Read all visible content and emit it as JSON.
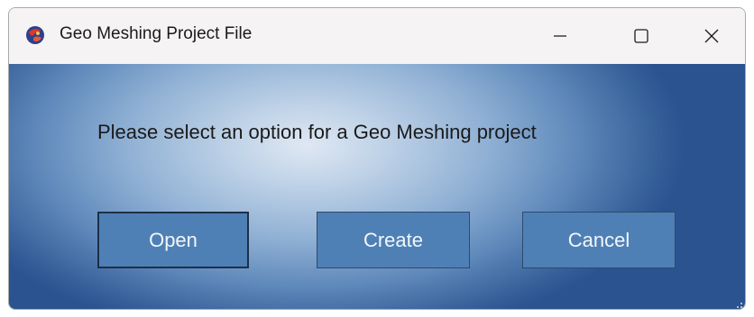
{
  "window": {
    "title": "Geo Meshing Project File",
    "icon": "app-globe-icon",
    "controls": {
      "minimize_icon": "minimize-icon",
      "maximize_icon": "maximize-icon",
      "close_icon": "close-icon"
    }
  },
  "dialog": {
    "prompt": "Please select an option for a Geo Meshing project",
    "buttons": {
      "open": "Open",
      "create": "Create",
      "cancel": "Cancel"
    }
  },
  "colors": {
    "button_fill": "#4f80b5",
    "button_border": "#2c4a6e",
    "background_light": "#dfe8f3",
    "background_dark": "#2a5390"
  }
}
